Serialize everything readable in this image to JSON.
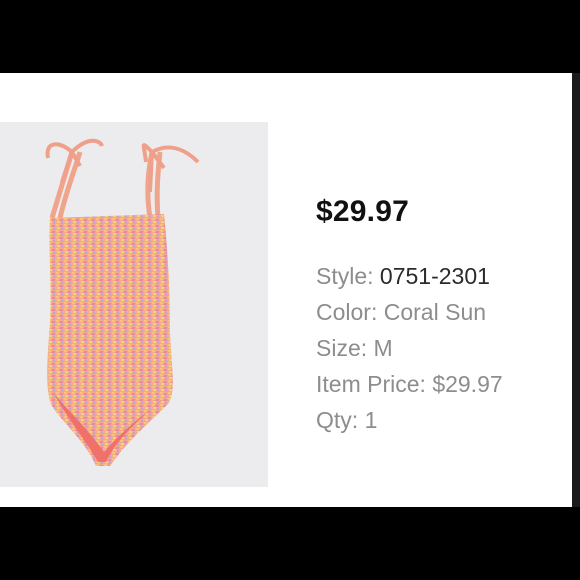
{
  "product": {
    "image_alt": "swimsuit-image",
    "price": "$29.97",
    "style_label": "Style:",
    "style_value": "0751-2301",
    "color_label": "Color:",
    "color_value": "Coral Sun",
    "size_label": "Size:",
    "size_value": "M",
    "item_price_label": "Item Price:",
    "item_price_value": "$29.97",
    "qty_label": "Qty:",
    "qty_value": "1"
  },
  "colors": {
    "swimsuit_base": "#f2a88f",
    "swimsuit_lining": "#f0706a",
    "background_image": "#ececee"
  }
}
